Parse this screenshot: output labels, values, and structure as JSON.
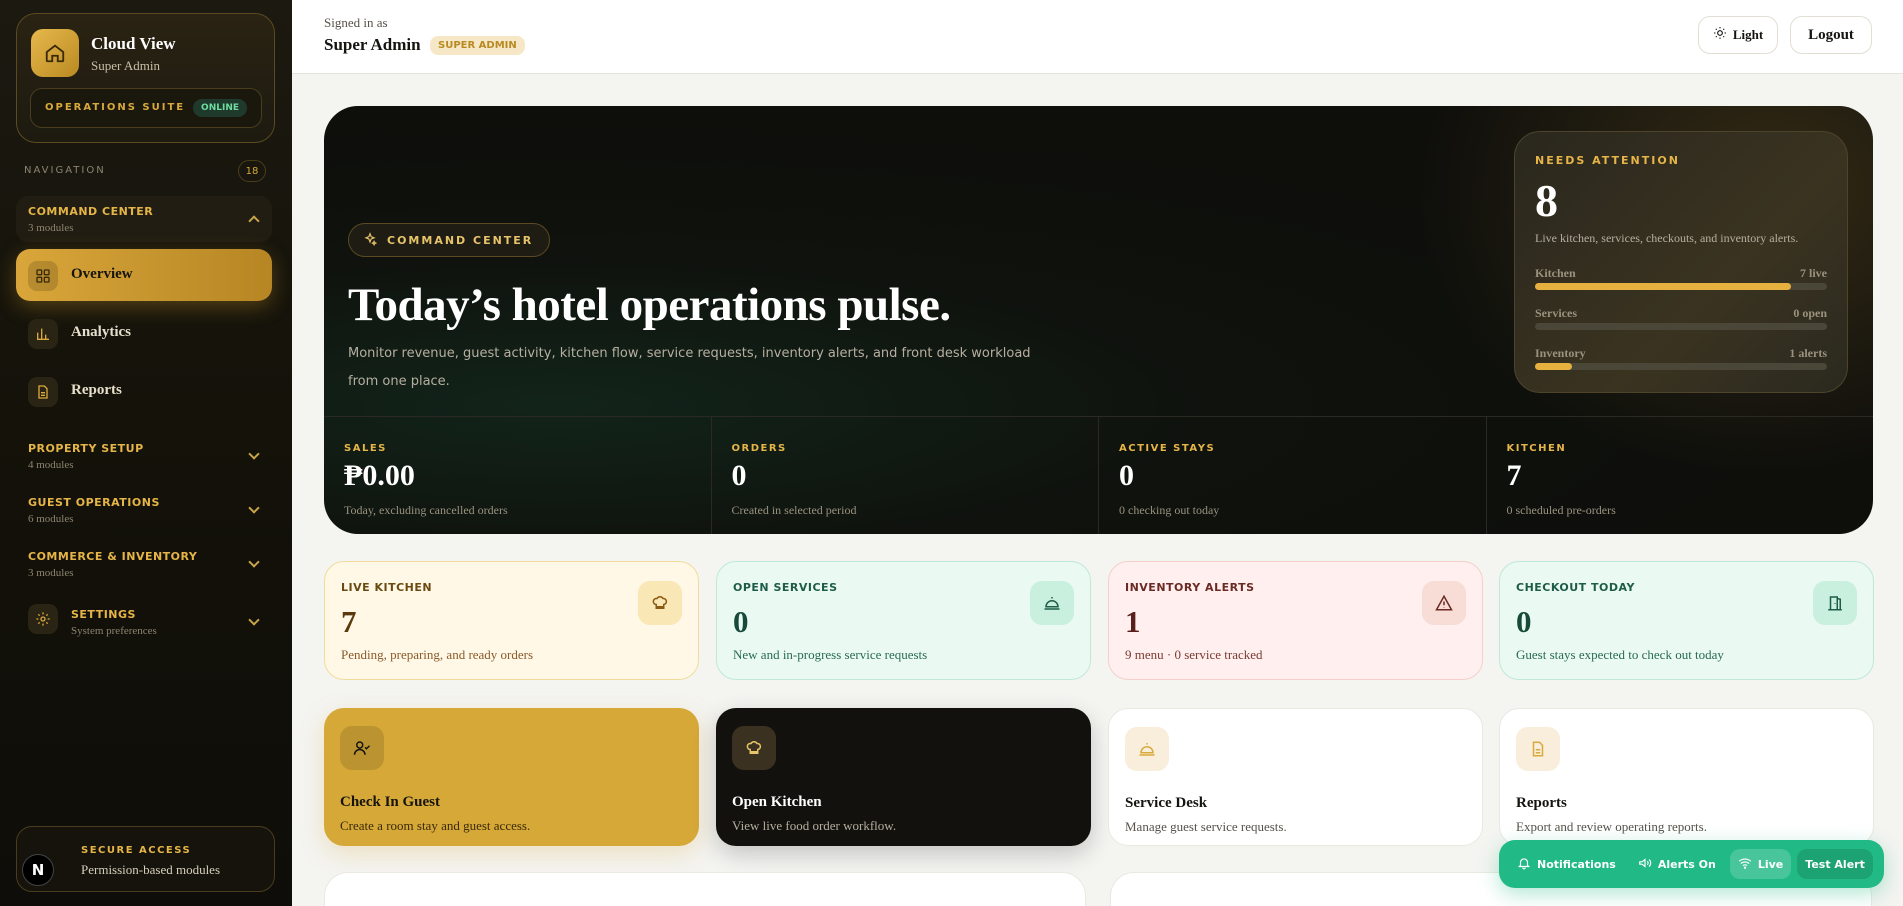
{
  "sidebar": {
    "brand_title": "Cloud View",
    "brand_subtitle": "Super Admin",
    "suite_label": "OPERATIONS SUITE",
    "status_badge": "ONLINE",
    "nav_heading": "NAVIGATION",
    "nav_count": "18",
    "groups": [
      {
        "title": "COMMAND CENTER",
        "subtitle": "3 modules",
        "expanded": true
      },
      {
        "title": "PROPERTY SETUP",
        "subtitle": "4 modules",
        "expanded": false
      },
      {
        "title": "GUEST OPERATIONS",
        "subtitle": "6 modules",
        "expanded": false
      },
      {
        "title": "COMMERCE & INVENTORY",
        "subtitle": "3 modules",
        "expanded": false
      },
      {
        "title": "SETTINGS",
        "subtitle": "System preferences",
        "expanded": false
      }
    ],
    "items": [
      {
        "label": "Overview",
        "icon": "grid-icon",
        "active": true
      },
      {
        "label": "Analytics",
        "icon": "bar-chart-icon",
        "active": false
      },
      {
        "label": "Reports",
        "icon": "document-icon",
        "active": false
      }
    ],
    "secure_title": "SECURE ACCESS",
    "secure_subtitle": "Permission-based modules",
    "n_badge": "N"
  },
  "header": {
    "signed_in_label": "Signed in as",
    "user_name": "Super Admin",
    "role_badge": "SUPER ADMIN",
    "theme_button": "Light",
    "logout_button": "Logout"
  },
  "hero": {
    "pill": "COMMAND CENTER",
    "title": "Today’s hotel operations pulse.",
    "description": "Monitor revenue, guest activity, kitchen flow, service requests, inventory alerts, and front desk workload from one place.",
    "attention": {
      "label": "NEEDS ATTENTION",
      "count": "8",
      "description": "Live kitchen, services, checkouts, and inventory alerts.",
      "bars": [
        {
          "name": "Kitchen",
          "value": "7 live",
          "fill": 0.875
        },
        {
          "name": "Services",
          "value": "0 open",
          "fill": 0
        },
        {
          "name": "Inventory",
          "value": "1 alerts",
          "fill": 0.125
        }
      ]
    },
    "stats": [
      {
        "label": "SALES",
        "value": "₱0.00",
        "sub": "Today, excluding cancelled orders"
      },
      {
        "label": "ORDERS",
        "value": "0",
        "sub": "Created in selected period"
      },
      {
        "label": "ACTIVE STAYS",
        "value": "0",
        "sub": "0 checking out today"
      },
      {
        "label": "KITCHEN",
        "value": "7",
        "sub": "0 scheduled pre-orders"
      }
    ]
  },
  "metrics": [
    {
      "label": "LIVE KITCHEN",
      "value": "7",
      "sub": "Pending, preparing, and ready orders",
      "icon": "chef-hat-icon",
      "bg": "#fff8e6",
      "border": "#f1dc9c",
      "label_color": "#6b4a12",
      "value_color": "#5a3a0c",
      "sub_color": "#8a5a2a",
      "icon_bg": "#f9e7b5"
    },
    {
      "label": "OPEN SERVICES",
      "value": "0",
      "sub": "New and in-progress service requests",
      "icon": "service-bell-icon",
      "bg": "#eafaf3",
      "border": "#bfe9d6",
      "label_color": "#1e5c48",
      "value_color": "#174a3a",
      "sub_color": "#2a6a55",
      "icon_bg": "#c9f0df"
    },
    {
      "label": "INVENTORY ALERTS",
      "value": "1",
      "sub": "9 menu · 0 service tracked",
      "icon": "warning-icon",
      "bg": "#fff0ef",
      "border": "#f4cfcb",
      "label_color": "#6b2a24",
      "value_color": "#5a1f1a",
      "sub_color": "#7a3a30",
      "icon_bg": "#f8dcd6"
    },
    {
      "label": "CHECKOUT TODAY",
      "value": "0",
      "sub": "Guest stays expected to check out today",
      "icon": "door-icon",
      "bg": "#eafaf3",
      "border": "#bfe9d6",
      "label_color": "#1e5c48",
      "value_color": "#174a3a",
      "sub_color": "#2a6a55",
      "icon_bg": "#c9f0df"
    }
  ],
  "actions": [
    {
      "title": "Check In Guest",
      "sub": "Create a room stay and guest access.",
      "icon": "user-check-icon"
    },
    {
      "title": "Open Kitchen",
      "sub": "View live food order workflow.",
      "icon": "chef-hat-icon"
    },
    {
      "title": "Service Desk",
      "sub": "Manage guest service requests.",
      "icon": "service-bell-icon"
    },
    {
      "title": "Reports",
      "sub": "Export and review operating reports.",
      "icon": "document-icon"
    }
  ],
  "notif_bar": {
    "notifications": "Notifications",
    "alerts": "Alerts On",
    "live": "Live",
    "test": "Test Alert"
  }
}
